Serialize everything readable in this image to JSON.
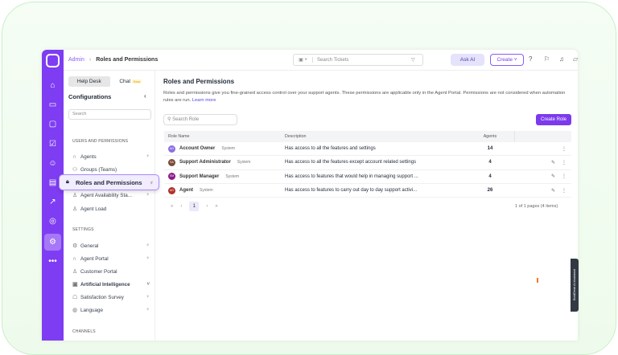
{
  "topbar": {
    "breadcrumb_root": "Admin",
    "breadcrumb_current": "Roles and Permissions",
    "search_placeholder": "Search Tickets",
    "ask_ai": "Ask AI",
    "create": "Create"
  },
  "config": {
    "tab_helpdesk": "Help Desk",
    "tab_chat": "Chat",
    "chat_badge": "Beta",
    "title": "Configurations",
    "search_placeholder": "Search",
    "sections": {
      "users": "USERS AND PERMISSIONS",
      "settings": "SETTINGS",
      "channels": "CHANNELS"
    },
    "users_items": [
      "Agents",
      "Groups (Teams)",
      "Roles and Permissions",
      "Agent Availability Sta...",
      "Agent Load"
    ],
    "settings_items": [
      "General",
      "Agent Portal",
      "Customer Portal",
      "Artificial Intelligence",
      "Satisfaction Survey",
      "Language"
    ]
  },
  "main": {
    "title": "Roles and Permissions",
    "description": "Roles and permissions give you fine-grained access control over your support agents. These permissions are applicable only in the Agent Portal. Permissions are not considered when automation rules are run.",
    "learn_more": "Learn more",
    "search_placeholder": "Search Role",
    "create_role": "Create Role",
    "columns": [
      "Role Name",
      "Description",
      "Agents"
    ],
    "rows": [
      {
        "initials": "AO",
        "color": "#8b6fe0",
        "name": "Account Owner",
        "tag": "System",
        "description": "Has access to all the features and settings",
        "agents": "14"
      },
      {
        "initials": "SA",
        "color": "#7a4a3a",
        "name": "Support Administrator",
        "tag": "System",
        "description": "Has access to all the features except account related settings",
        "agents": "4"
      },
      {
        "initials": "SM",
        "color": "#8a1a8a",
        "name": "Support Manager",
        "tag": "System",
        "description": "Has access to features that would help in managing support ...",
        "agents": "4"
      },
      {
        "initials": "AG",
        "color": "#b0302a",
        "name": "Agent",
        "tag": "System",
        "description": "Has access to features to carry out day to day support activi...",
        "agents": "26"
      }
    ],
    "page": "1",
    "page_info": "1 of 1 pages (4 items)"
  },
  "assistant_tab": "BoldDesk AI Assistant"
}
